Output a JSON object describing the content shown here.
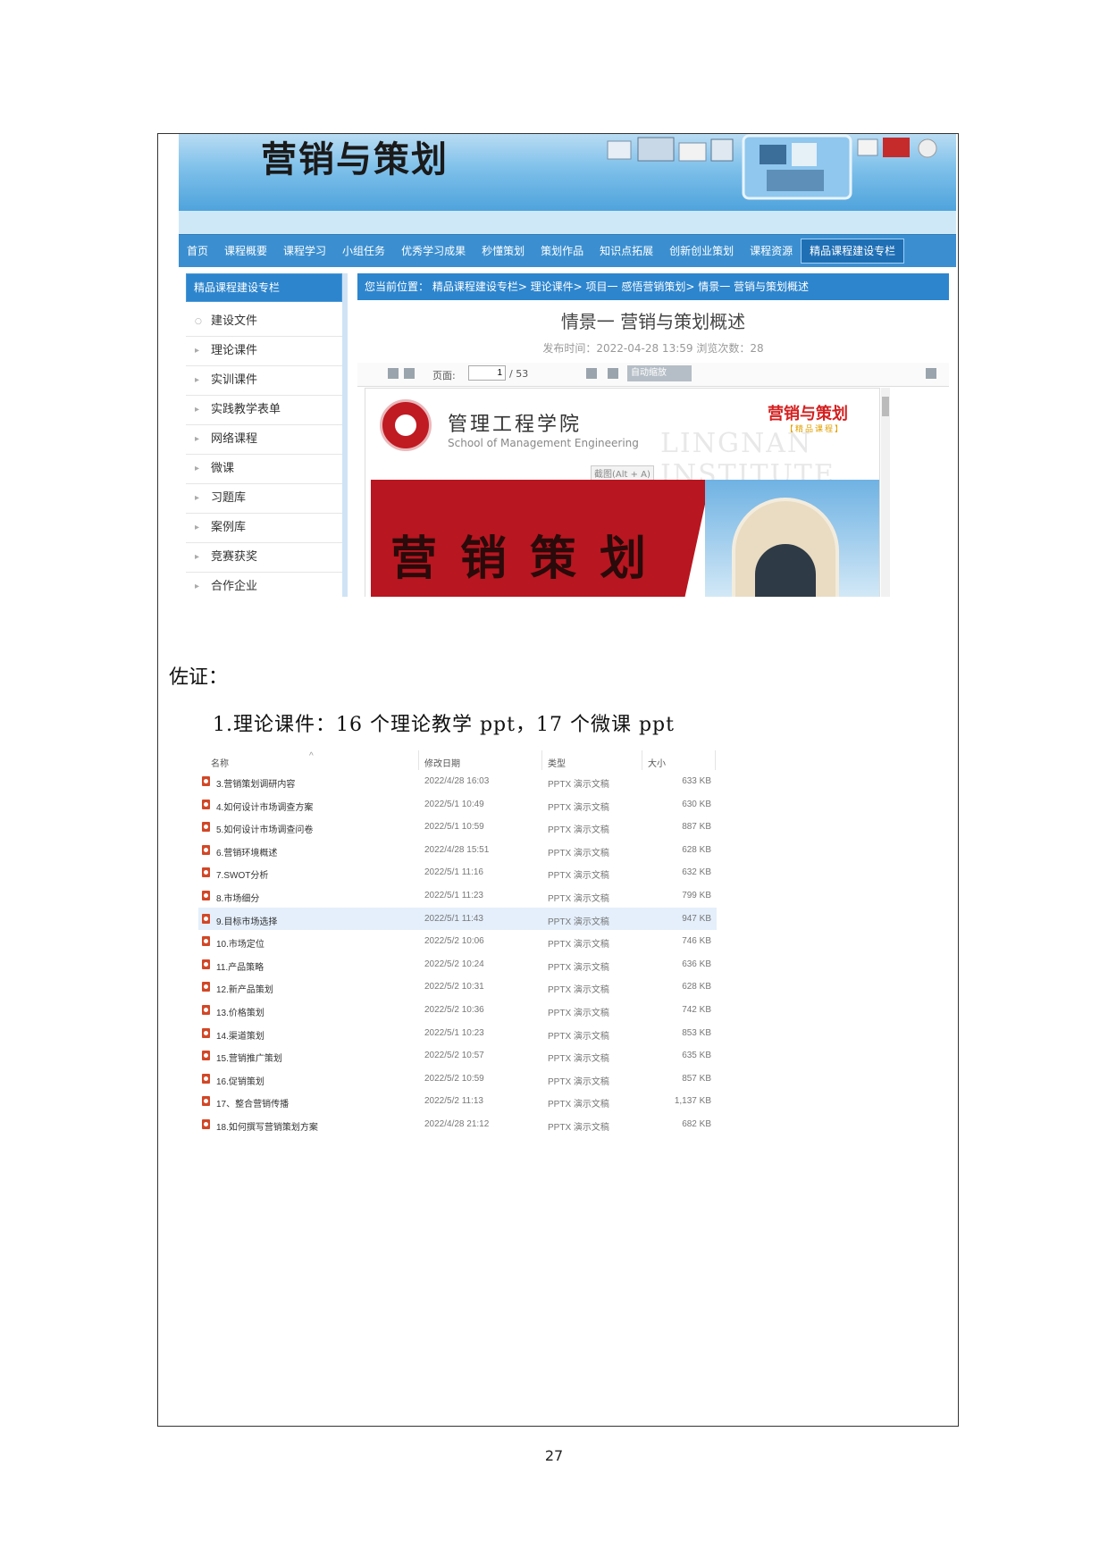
{
  "website": {
    "banner_title": "营销与策划",
    "nav": [
      "首页",
      "课程概要",
      "课程学习",
      "小组任务",
      "优秀学习成果",
      "秒懂策划",
      "策划作品",
      "知识点拓展",
      "创新创业策划",
      "课程资源",
      "精品课程建设专栏"
    ],
    "sidebar": {
      "heading": "精品课程建设专栏",
      "items": [
        "建设文件",
        "理论课件",
        "实训课件",
        "实践教学表单",
        "网络课程",
        "微课",
        "习题库",
        "案例库",
        "竞赛获奖",
        "合作企业"
      ]
    },
    "breadcrumb": "您当前位置： 精品课程建设专栏> 理论课件> 项目一 感悟营销策划> 情景一 营销与策划概述",
    "article_title": "情景一 营销与策划概述",
    "article_meta": "发布时间：2022-04-28 13:59 浏览次数：28",
    "viewer": {
      "page_label": "页面:",
      "page_value": "1",
      "page_total": "/ 53",
      "zoom": "自动缩放"
    },
    "slide": {
      "school_cn": "管理工程学院",
      "school_en": "School of Management Engineering",
      "watermark": "LINGNAN INSTITUTE",
      "brand": "营销与策划",
      "brand_sub": "【精品课程】",
      "capture_hint": "截图(Alt + A)",
      "title": "营销策划"
    }
  },
  "evidence_label": "佐证：",
  "item1": "1.理论课件：16 个理论教学 ppt，17 个微课 ppt",
  "file_list": {
    "headers": {
      "name": "名称",
      "date": "修改日期",
      "type": "类型",
      "size": "大小"
    },
    "rows": [
      {
        "name": "3.营销策划调研内容",
        "date": "2022/4/28 16:03",
        "type": "PPTX 演示文稿",
        "size": "633 KB"
      },
      {
        "name": "4.如何设计市场调查方案",
        "date": "2022/5/1 10:49",
        "type": "PPTX 演示文稿",
        "size": "630 KB"
      },
      {
        "name": "5.如何设计市场调查问卷",
        "date": "2022/5/1 10:59",
        "type": "PPTX 演示文稿",
        "size": "887 KB"
      },
      {
        "name": "6.营销环境概述",
        "date": "2022/4/28 15:51",
        "type": "PPTX 演示文稿",
        "size": "628 KB"
      },
      {
        "name": "7.SWOT分析",
        "date": "2022/5/1 11:16",
        "type": "PPTX 演示文稿",
        "size": "632 KB"
      },
      {
        "name": "8.市场细分",
        "date": "2022/5/1 11:23",
        "type": "PPTX 演示文稿",
        "size": "799 KB"
      },
      {
        "name": "9.目标市场选择",
        "date": "2022/5/1 11:43",
        "type": "PPTX 演示文稿",
        "size": "947 KB"
      },
      {
        "name": "10.市场定位",
        "date": "2022/5/2 10:06",
        "type": "PPTX 演示文稿",
        "size": "746 KB"
      },
      {
        "name": "11.产品策略",
        "date": "2022/5/2 10:24",
        "type": "PPTX 演示文稿",
        "size": "636 KB"
      },
      {
        "name": "12.新产品策划",
        "date": "2022/5/2 10:31",
        "type": "PPTX 演示文稿",
        "size": "628 KB"
      },
      {
        "name": "13.价格策划",
        "date": "2022/5/2 10:36",
        "type": "PPTX 演示文稿",
        "size": "742 KB"
      },
      {
        "name": "14.渠道策划",
        "date": "2022/5/1 10:23",
        "type": "PPTX 演示文稿",
        "size": "853 KB"
      },
      {
        "name": "15.营销推广策划",
        "date": "2022/5/2 10:57",
        "type": "PPTX 演示文稿",
        "size": "635 KB"
      },
      {
        "name": "16.促销策划",
        "date": "2022/5/2 10:59",
        "type": "PPTX 演示文稿",
        "size": "857 KB"
      },
      {
        "name": "17、整合营销传播",
        "date": "2022/5/2 11:13",
        "type": "PPTX 演示文稿",
        "size": "1,137 KB"
      },
      {
        "name": "18.如何撰写营销策划方案",
        "date": "2022/4/28 21:12",
        "type": "PPTX 演示文稿",
        "size": "682 KB"
      }
    ],
    "selected_index": 6
  },
  "page_number": "27"
}
